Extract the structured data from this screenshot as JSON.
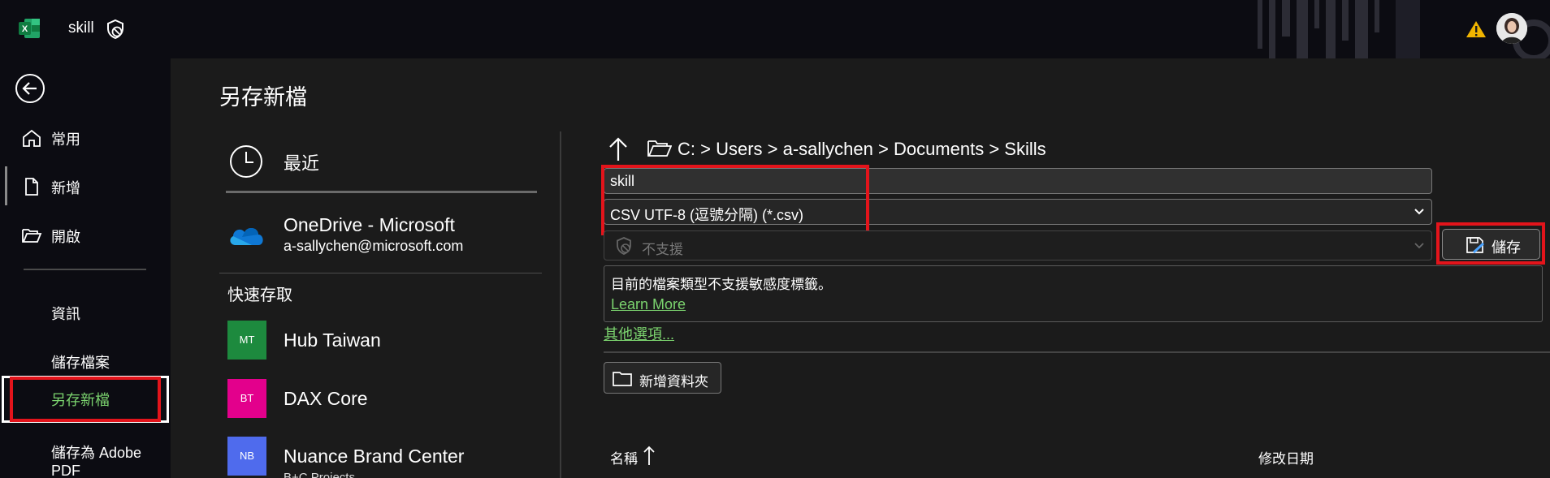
{
  "titlebar": {
    "doc_name": "skill",
    "app": "Excel"
  },
  "nav": {
    "home": "常用",
    "new": "新增",
    "open": "開啟",
    "info": "資訊",
    "save": "儲存檔案",
    "save_as": "另存新檔",
    "save_pdf": "儲存為 Adobe PDF"
  },
  "page_title": "另存新檔",
  "locations": {
    "recent": "最近",
    "onedrive_name": "OneDrive - Microsoft",
    "onedrive_email": "a-sallychen@microsoft.com",
    "quick_access_title": "快速存取",
    "quick": [
      {
        "badge": "MT",
        "name": "Hub Taiwan",
        "color": "#1d8a3e"
      },
      {
        "badge": "BT",
        "name": "DAX Core",
        "color": "#e3008c"
      },
      {
        "badge": "NB",
        "name": "Nuance Brand Center",
        "sub": "B+C Projects",
        "color": "#4f6bed"
      }
    ]
  },
  "path": "C: > Users > a-sallychen > Documents > Skills",
  "file_name": "skill",
  "file_type": "CSV UTF-8 (逗號分隔) (*.csv)",
  "sensitivity": "不支援",
  "save_button": "儲存",
  "info": {
    "message": "目前的檔案類型不支援敏感度標籤。",
    "learn_more": "Learn More"
  },
  "more_options": "其他選項...",
  "new_folder": "新增資料夾",
  "columns": {
    "name": "名稱",
    "date": "修改日期"
  },
  "colors": {
    "accent_link": "#7bd36e",
    "highlight": "#e3141b",
    "sidebar_bg": "#0c0c12",
    "main_bg": "#1b1b1b"
  }
}
